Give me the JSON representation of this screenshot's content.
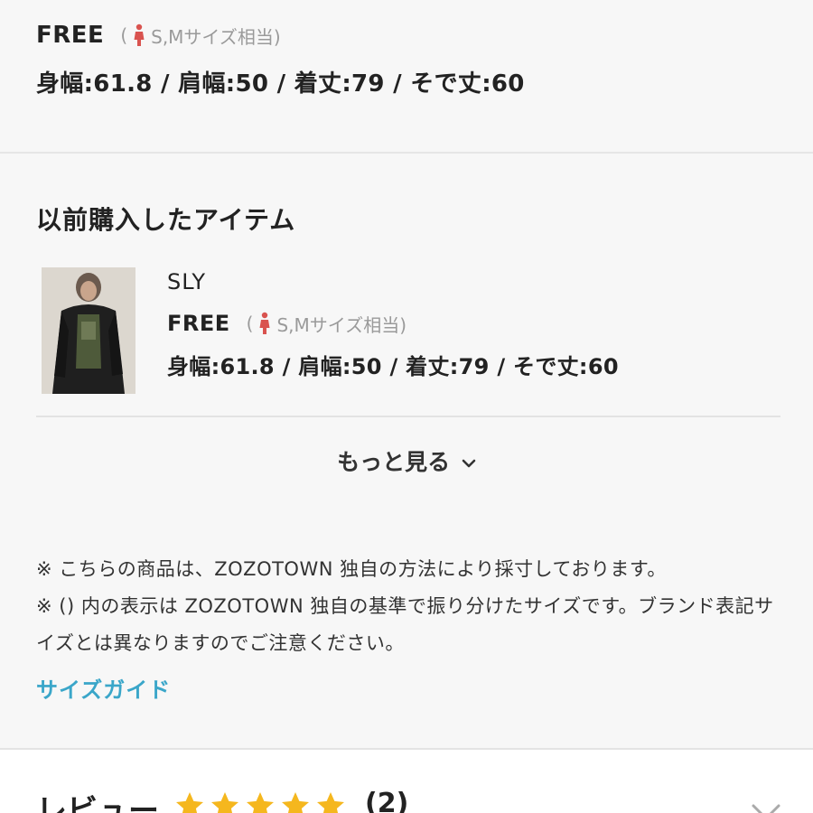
{
  "top": {
    "size_name": "FREE",
    "size_note_open": "(",
    "size_note_text": "S,Mサイズ相当)",
    "measurements": "身幅:61.8 / 肩幅:50 / 着丈:79 / そで丈:60"
  },
  "purchased": {
    "title": "以前購入したアイテム",
    "item": {
      "brand": "SLY",
      "size_name": "FREE",
      "size_note_open": "(",
      "size_note_text": "S,Mサイズ相当)",
      "measurements": "身幅:61.8 / 肩幅:50 / 着丈:79 / そで丈:60"
    },
    "more_label": "もっと見る"
  },
  "notes": [
    "※ こちらの商品は、ZOZOTOWN 独自の方法により採寸しております。",
    "※ () 内の表示は ZOZOTOWN 独自の基準で振り分けたサイズです。ブランド表記サイズとは異なりますのでご注意ください。"
  ],
  "size_guide_label": "サイズガイド",
  "review": {
    "title": "レビュー",
    "rating": 5,
    "count": "(2)"
  },
  "colors": {
    "accent_link": "#3aa6c9",
    "star": "#f5b71e",
    "person_icon": "#d9534f"
  },
  "icons": {
    "person": "person-icon",
    "chevron": "chevron-down-icon",
    "star": "star-icon"
  }
}
